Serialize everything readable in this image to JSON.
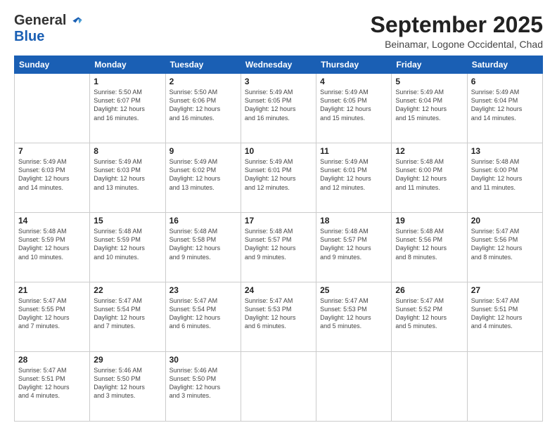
{
  "logo": {
    "general": "General",
    "blue": "Blue"
  },
  "header": {
    "month": "September 2025",
    "location": "Beinamar, Logone Occidental, Chad"
  },
  "weekdays": [
    "Sunday",
    "Monday",
    "Tuesday",
    "Wednesday",
    "Thursday",
    "Friday",
    "Saturday"
  ],
  "weeks": [
    [
      {
        "day": "",
        "info": ""
      },
      {
        "day": "1",
        "info": "Sunrise: 5:50 AM\nSunset: 6:07 PM\nDaylight: 12 hours\nand 16 minutes."
      },
      {
        "day": "2",
        "info": "Sunrise: 5:50 AM\nSunset: 6:06 PM\nDaylight: 12 hours\nand 16 minutes."
      },
      {
        "day": "3",
        "info": "Sunrise: 5:49 AM\nSunset: 6:05 PM\nDaylight: 12 hours\nand 16 minutes."
      },
      {
        "day": "4",
        "info": "Sunrise: 5:49 AM\nSunset: 6:05 PM\nDaylight: 12 hours\nand 15 minutes."
      },
      {
        "day": "5",
        "info": "Sunrise: 5:49 AM\nSunset: 6:04 PM\nDaylight: 12 hours\nand 15 minutes."
      },
      {
        "day": "6",
        "info": "Sunrise: 5:49 AM\nSunset: 6:04 PM\nDaylight: 12 hours\nand 14 minutes."
      }
    ],
    [
      {
        "day": "7",
        "info": "Sunrise: 5:49 AM\nSunset: 6:03 PM\nDaylight: 12 hours\nand 14 minutes."
      },
      {
        "day": "8",
        "info": "Sunrise: 5:49 AM\nSunset: 6:03 PM\nDaylight: 12 hours\nand 13 minutes."
      },
      {
        "day": "9",
        "info": "Sunrise: 5:49 AM\nSunset: 6:02 PM\nDaylight: 12 hours\nand 13 minutes."
      },
      {
        "day": "10",
        "info": "Sunrise: 5:49 AM\nSunset: 6:01 PM\nDaylight: 12 hours\nand 12 minutes."
      },
      {
        "day": "11",
        "info": "Sunrise: 5:49 AM\nSunset: 6:01 PM\nDaylight: 12 hours\nand 12 minutes."
      },
      {
        "day": "12",
        "info": "Sunrise: 5:48 AM\nSunset: 6:00 PM\nDaylight: 12 hours\nand 11 minutes."
      },
      {
        "day": "13",
        "info": "Sunrise: 5:48 AM\nSunset: 6:00 PM\nDaylight: 12 hours\nand 11 minutes."
      }
    ],
    [
      {
        "day": "14",
        "info": "Sunrise: 5:48 AM\nSunset: 5:59 PM\nDaylight: 12 hours\nand 10 minutes."
      },
      {
        "day": "15",
        "info": "Sunrise: 5:48 AM\nSunset: 5:59 PM\nDaylight: 12 hours\nand 10 minutes."
      },
      {
        "day": "16",
        "info": "Sunrise: 5:48 AM\nSunset: 5:58 PM\nDaylight: 12 hours\nand 9 minutes."
      },
      {
        "day": "17",
        "info": "Sunrise: 5:48 AM\nSunset: 5:57 PM\nDaylight: 12 hours\nand 9 minutes."
      },
      {
        "day": "18",
        "info": "Sunrise: 5:48 AM\nSunset: 5:57 PM\nDaylight: 12 hours\nand 9 minutes."
      },
      {
        "day": "19",
        "info": "Sunrise: 5:48 AM\nSunset: 5:56 PM\nDaylight: 12 hours\nand 8 minutes."
      },
      {
        "day": "20",
        "info": "Sunrise: 5:47 AM\nSunset: 5:56 PM\nDaylight: 12 hours\nand 8 minutes."
      }
    ],
    [
      {
        "day": "21",
        "info": "Sunrise: 5:47 AM\nSunset: 5:55 PM\nDaylight: 12 hours\nand 7 minutes."
      },
      {
        "day": "22",
        "info": "Sunrise: 5:47 AM\nSunset: 5:54 PM\nDaylight: 12 hours\nand 7 minutes."
      },
      {
        "day": "23",
        "info": "Sunrise: 5:47 AM\nSunset: 5:54 PM\nDaylight: 12 hours\nand 6 minutes."
      },
      {
        "day": "24",
        "info": "Sunrise: 5:47 AM\nSunset: 5:53 PM\nDaylight: 12 hours\nand 6 minutes."
      },
      {
        "day": "25",
        "info": "Sunrise: 5:47 AM\nSunset: 5:53 PM\nDaylight: 12 hours\nand 5 minutes."
      },
      {
        "day": "26",
        "info": "Sunrise: 5:47 AM\nSunset: 5:52 PM\nDaylight: 12 hours\nand 5 minutes."
      },
      {
        "day": "27",
        "info": "Sunrise: 5:47 AM\nSunset: 5:51 PM\nDaylight: 12 hours\nand 4 minutes."
      }
    ],
    [
      {
        "day": "28",
        "info": "Sunrise: 5:47 AM\nSunset: 5:51 PM\nDaylight: 12 hours\nand 4 minutes."
      },
      {
        "day": "29",
        "info": "Sunrise: 5:46 AM\nSunset: 5:50 PM\nDaylight: 12 hours\nand 3 minutes."
      },
      {
        "day": "30",
        "info": "Sunrise: 5:46 AM\nSunset: 5:50 PM\nDaylight: 12 hours\nand 3 minutes."
      },
      {
        "day": "",
        "info": ""
      },
      {
        "day": "",
        "info": ""
      },
      {
        "day": "",
        "info": ""
      },
      {
        "day": "",
        "info": ""
      }
    ]
  ]
}
